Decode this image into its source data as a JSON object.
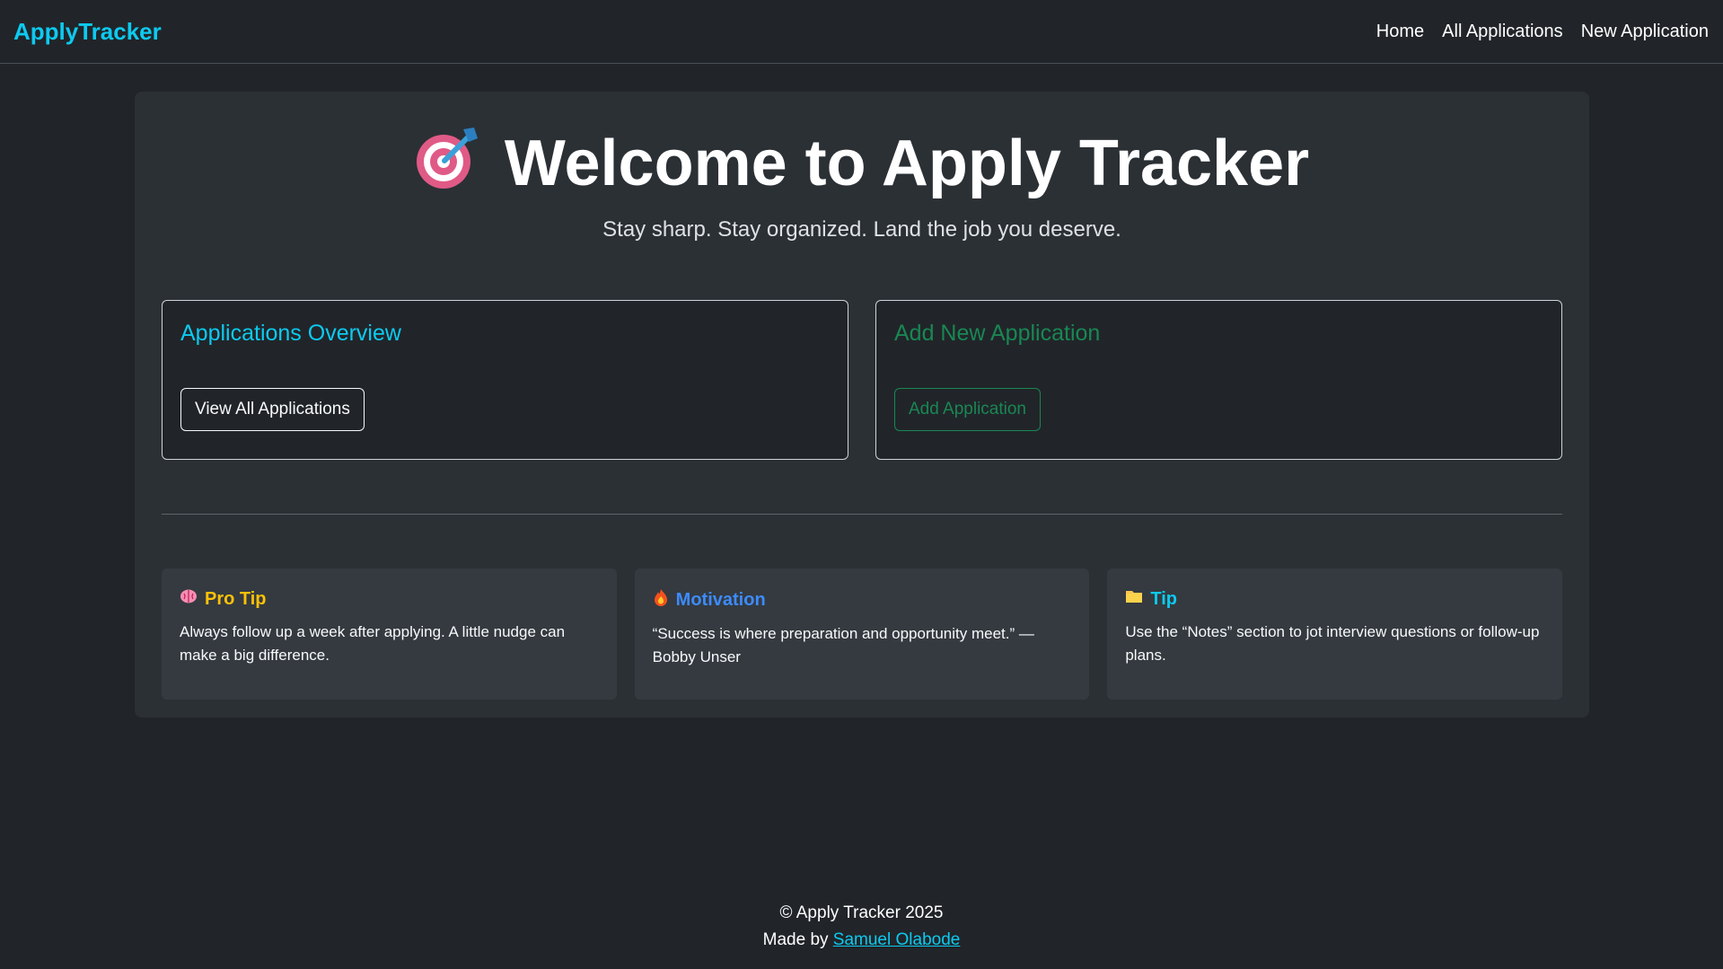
{
  "nav": {
    "brand": "ApplyTracker",
    "links": [
      "Home",
      "All Applications",
      "New Application"
    ]
  },
  "hero": {
    "title": "Welcome to Apply Tracker",
    "subtitle": "Stay sharp. Stay organized. Land the job you deserve.",
    "icon": "target-icon"
  },
  "cards": {
    "overview": {
      "title": "Applications Overview",
      "button": "View All Applications"
    },
    "add": {
      "title": "Add New Application",
      "button": "Add Application"
    }
  },
  "tips": [
    {
      "icon": "brain-icon",
      "title": "Pro Tip",
      "text": "Always follow up a week after applying. A little nudge can make a big difference."
    },
    {
      "icon": "fire-icon",
      "title": "Motivation",
      "text": "“Success is where preparation and opportunity meet.” — Bobby Unser"
    },
    {
      "icon": "folder-icon",
      "title": "Tip",
      "text": "Use the “Notes” section to jot interview questions or follow-up plans."
    }
  ],
  "footer": {
    "copyright": "© Apply Tracker 2025",
    "made_by": "Made by",
    "author": "Samuel Olabode"
  },
  "colors": {
    "background": "#212529",
    "panel": "#2b3035",
    "info": "#0dcaf0",
    "success": "#198754",
    "warning": "#ffc107",
    "primary": "#3d8bfd"
  }
}
